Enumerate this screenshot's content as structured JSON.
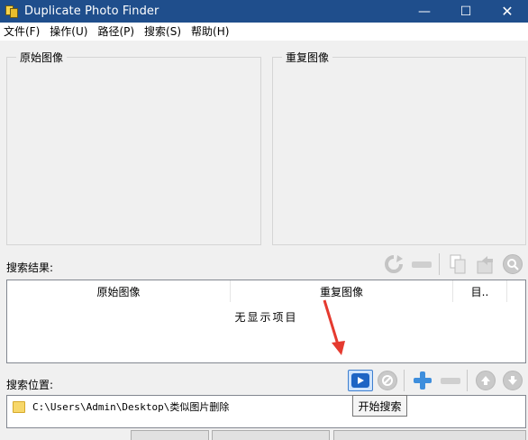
{
  "window": {
    "title": "Duplicate Photo Finder",
    "minimize": "—",
    "maximize": "☐",
    "close": "✕"
  },
  "menu": [
    {
      "label": "文件(F)"
    },
    {
      "label": "操作(U)"
    },
    {
      "label": "路径(P)"
    },
    {
      "label": "搜索(S)"
    },
    {
      "label": "帮助(H)"
    }
  ],
  "panels": {
    "original_title": "原始图像",
    "duplicate_title": "重复图像"
  },
  "results": {
    "label": "搜索结果:",
    "columns": [
      "原始图像",
      "重复图像",
      "目.."
    ],
    "empty_text": "无显示项目"
  },
  "search": {
    "label": "搜索位置:",
    "locations": [
      "C:\\Users\\Admin\\Desktop\\类似图片删除"
    ],
    "tooltip": "开始搜索"
  },
  "icons": {
    "refresh": "↻",
    "minus": "−",
    "plus": "+"
  },
  "colors": {
    "titlebar": "#1f4e8c",
    "accent_blue": "#1d64c4",
    "arrow_red": "#e53a2f"
  }
}
